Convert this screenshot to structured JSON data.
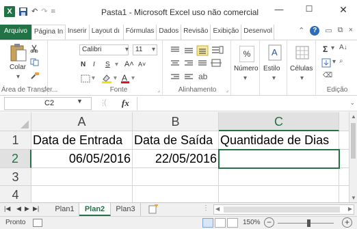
{
  "titlebar": {
    "app_icon": "X",
    "qat_save": "save-icon",
    "qat_undo": "↶",
    "qat_redo": "↷",
    "qat_customize": "=",
    "title": "Pasta1 - Microsoft Excel uso não comercial",
    "minimize": "—",
    "maximize": "☐",
    "close": "✕"
  },
  "ribbon_tabs": [
    {
      "label": "Arquivo"
    },
    {
      "label": "Página In"
    },
    {
      "label": "Inserir"
    },
    {
      "label": "Layout dı"
    },
    {
      "label": "Fórmulas"
    },
    {
      "label": "Dados"
    },
    {
      "label": "Revisão"
    },
    {
      "label": "Exibição"
    },
    {
      "label": "Desenvol"
    }
  ],
  "ribbon": {
    "clipboard": {
      "paste_label": "Colar",
      "group_label": "Área de Transfer..."
    },
    "font": {
      "font_name": "Calibri",
      "font_size": "11",
      "bold": "N",
      "italic": "I",
      "underline": "S",
      "grow": "A˄",
      "shrink": "A˅",
      "group_label": "Fonte"
    },
    "alignment": {
      "group_label": "Alinhamento"
    },
    "number": {
      "percent": "%",
      "label": "Número"
    },
    "styles": {
      "label": "Estilo"
    },
    "cells": {
      "label": "Células"
    },
    "editing": {
      "sum": "Σ",
      "group_label": "Edição"
    }
  },
  "formula_bar": {
    "name_box": "C2",
    "fx": "fx",
    "formula": ""
  },
  "columns": [
    "A",
    "B",
    "C"
  ],
  "rows": [
    "1",
    "2",
    "3",
    "4"
  ],
  "cells": {
    "A1": "Data de Entrada",
    "B1": "Data de Saída",
    "C1": "Quantidade de Dias",
    "A2": "06/05/2016",
    "B2": "22/05/2016",
    "C2": ""
  },
  "selected_cell": "C2",
  "sheets": [
    {
      "label": "Plan1"
    },
    {
      "label": "Plan2"
    },
    {
      "label": "Plan3"
    }
  ],
  "active_sheet": "Plan2",
  "status": {
    "mode": "Pronto",
    "zoom": "150%",
    "zoom_minus": "−",
    "zoom_plus": "+"
  },
  "colors": {
    "accent": "#217346",
    "file_tab": "#217346"
  }
}
